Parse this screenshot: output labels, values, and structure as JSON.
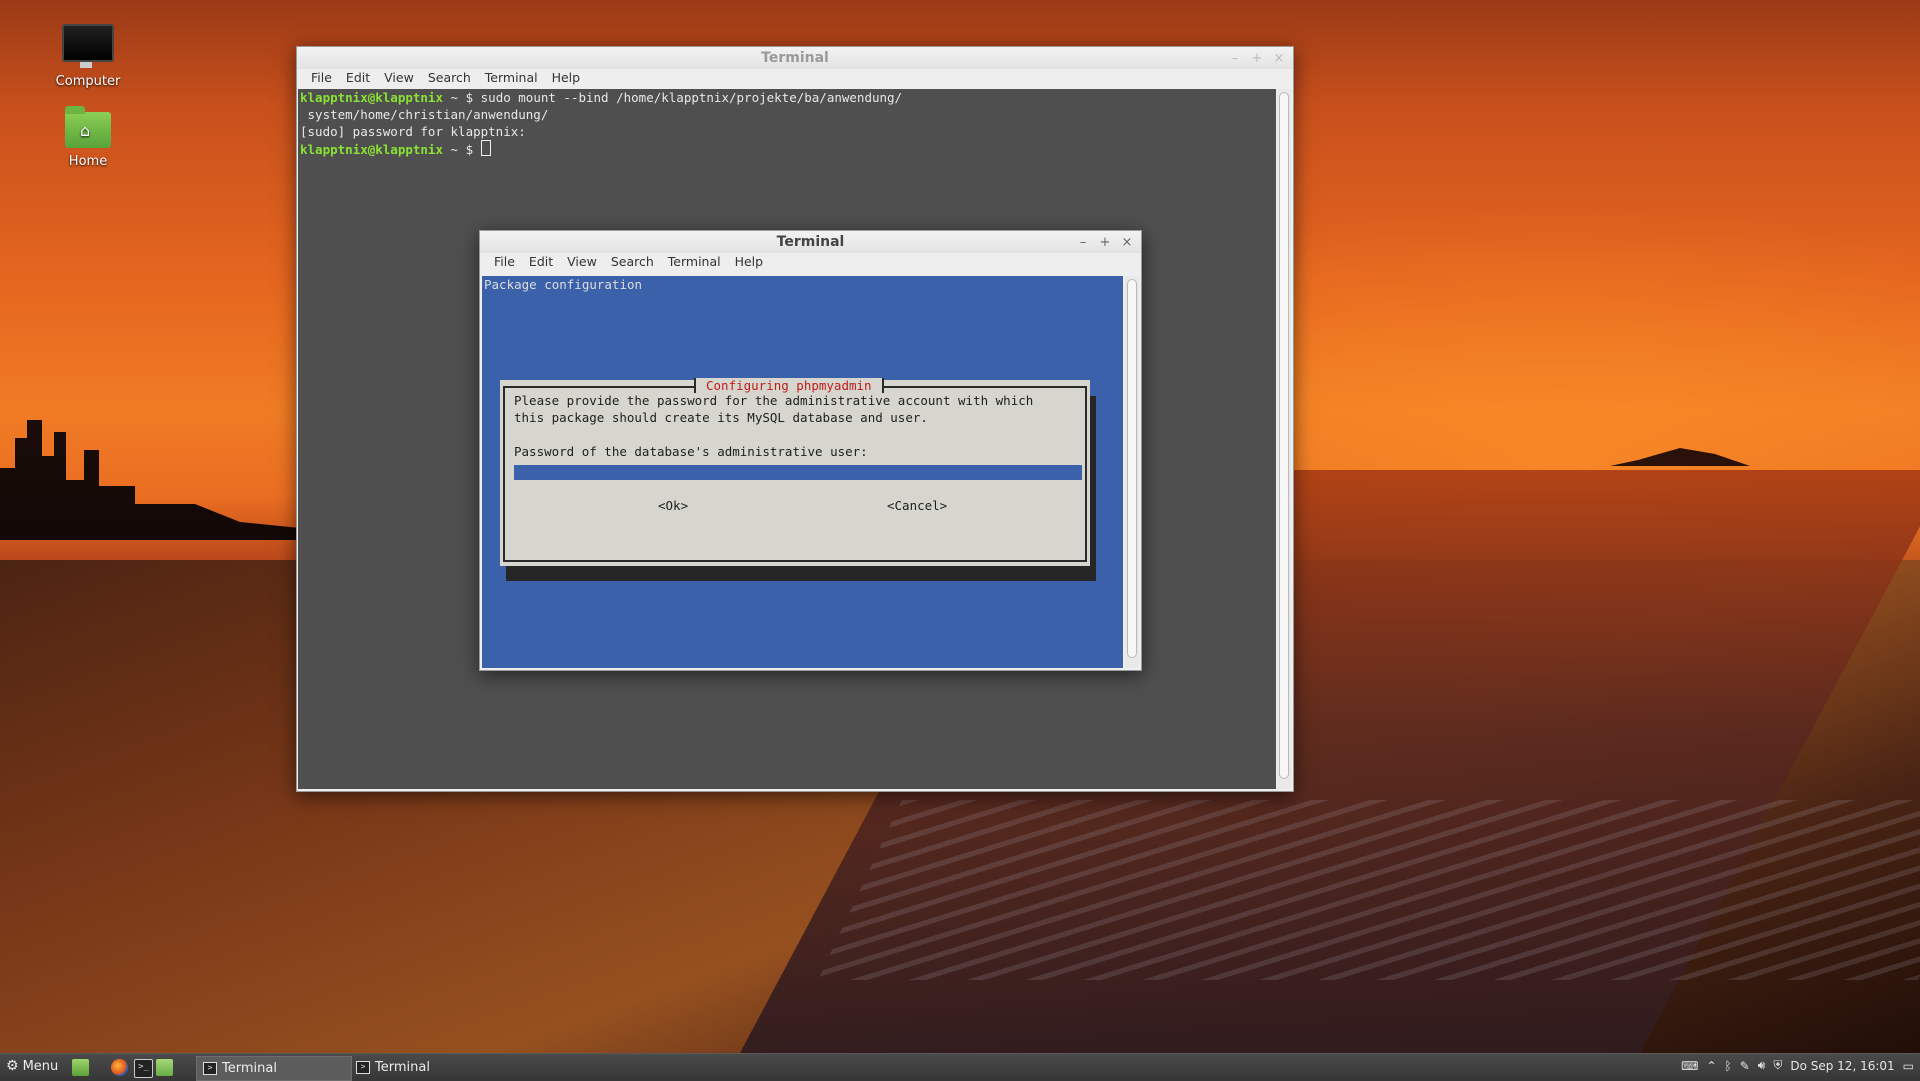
{
  "desktop": {
    "icons": [
      {
        "label": "Computer",
        "icon": "computer-icon"
      },
      {
        "label": "Home",
        "icon": "home-folder-icon"
      }
    ]
  },
  "back_terminal": {
    "title": "Terminal",
    "menu": [
      "File",
      "Edit",
      "View",
      "Search",
      "Terminal",
      "Help"
    ],
    "lines": [
      {
        "user": "klapptnix@klapptnix",
        "sep": " ~ $ ",
        "cmd": "sudo mount --bind /home/klapptnix/projekte/ba/anwendung/"
      },
      {
        "text": " system/home/christian/anwendung/"
      },
      {
        "text": "[sudo] password for klapptnix:"
      },
      {
        "user": "klapptnix@klapptnix",
        "sep": " ~ $ "
      }
    ]
  },
  "front_terminal": {
    "title": "Terminal",
    "menu": [
      "File",
      "Edit",
      "View",
      "Search",
      "Terminal",
      "Help"
    ],
    "package_title": "Package configuration",
    "dialog": {
      "title": "Configuring phpmyadmin",
      "message_line1": "Please provide the password for the administrative account with which",
      "message_line2": "this package should create its MySQL database and user.",
      "prompt": "Password of the database's administrative user:",
      "password_value": "",
      "ok_label": "<Ok>",
      "cancel_label": "<Cancel>"
    }
  },
  "window_controls": {
    "minimize": "–",
    "maximize": "+",
    "close": "×"
  },
  "taskbar": {
    "menu_label": "Menu",
    "tasks": [
      {
        "label": "Terminal",
        "active": true
      },
      {
        "label": "Terminal",
        "active": false
      }
    ],
    "clock": "Do Sep 12, 16:01"
  },
  "colors": {
    "ncurses_blue": "#3b61ab",
    "prompt_green": "#8ae234",
    "dialog_title_red": "#c01c1c",
    "dialog_gray": "#d6d6cf"
  }
}
